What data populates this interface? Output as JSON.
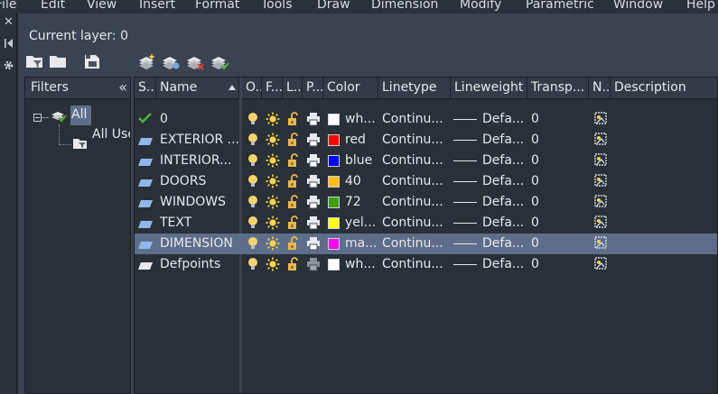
{
  "menu": [
    "File",
    "Edit",
    "View",
    "Insert",
    "Format",
    "Tools",
    "Draw",
    "Dimension",
    "Modify",
    "Parametric",
    "Window",
    "Help"
  ],
  "current_layer": "Current layer: 0",
  "filters": {
    "title": "Filters",
    "tree": [
      {
        "label": "All",
        "selected": true
      },
      {
        "label": "All Used Layers",
        "selected": false
      }
    ]
  },
  "columns": [
    "S...",
    "Name",
    "O...",
    "F...",
    "L...",
    "P...",
    "Color",
    "Linetype",
    "Lineweight",
    "Transp...",
    "N...",
    "Description"
  ],
  "layers": [
    {
      "status": "current",
      "name": "0",
      "color_name": "wh...",
      "color_hex": "#ffffff",
      "linetype": "Continu...",
      "lineweight": "Defa...",
      "transparency": "0",
      "plot": true,
      "selected": false
    },
    {
      "status": "layer",
      "name": "EXTERIOR ...",
      "color_name": "red",
      "color_hex": "#ff0000",
      "linetype": "Continu...",
      "lineweight": "Defa...",
      "transparency": "0",
      "plot": true,
      "selected": false
    },
    {
      "status": "layer",
      "name": "INTERIOR...",
      "color_name": "blue",
      "color_hex": "#0000ff",
      "linetype": "Continu...",
      "lineweight": "Defa...",
      "transparency": "0",
      "plot": true,
      "selected": false
    },
    {
      "status": "layer",
      "name": "DOORS",
      "color_name": "40",
      "color_hex": "#ffbf00",
      "linetype": "Continu...",
      "lineweight": "Defa...",
      "transparency": "0",
      "plot": true,
      "selected": false
    },
    {
      "status": "layer",
      "name": "WINDOWS",
      "color_name": "72",
      "color_hex": "#3f9f0f",
      "linetype": "Continu...",
      "lineweight": "Defa...",
      "transparency": "0",
      "plot": true,
      "selected": false
    },
    {
      "status": "layer",
      "name": "TEXT",
      "color_name": "yel...",
      "color_hex": "#ffff00",
      "linetype": "Continu...",
      "lineweight": "Defa...",
      "transparency": "0",
      "plot": true,
      "selected": false
    },
    {
      "status": "layer",
      "name": "DIMENSION",
      "color_name": "ma...",
      "color_hex": "#ff00ff",
      "linetype": "Continu...",
      "lineweight": "Defa...",
      "transparency": "0",
      "plot": true,
      "selected": true
    },
    {
      "status": "layer-defpoints",
      "name": "Defpoints",
      "color_name": "wh...",
      "color_hex": "#ffffff",
      "linetype": "Continu...",
      "lineweight": "Defa...",
      "transparency": "0",
      "plot": false,
      "selected": false
    }
  ],
  "colors": {
    "accent_selection": "#5d6e8b",
    "bulb_on": "#f4d46a",
    "sun": "#f7d24b",
    "lock_open": "#e8b84a",
    "current_check": "#4caf3f",
    "layer_icon": "#8fb8e8"
  }
}
